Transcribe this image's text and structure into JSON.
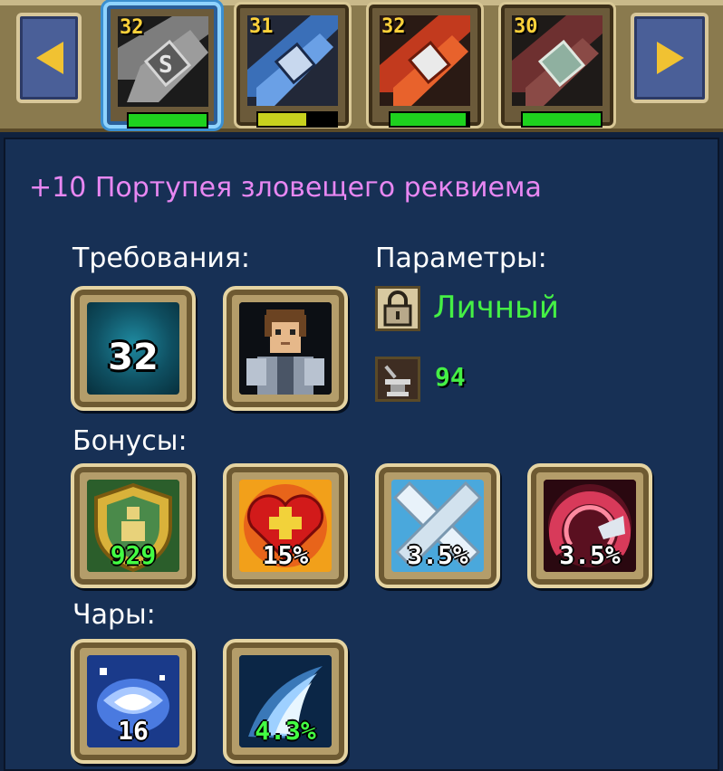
{
  "item_bar": {
    "slots": [
      {
        "level": "32",
        "durability": 1.0,
        "bar_color": "#1ed21e",
        "selected": true,
        "icon": "belt-iron-icon"
      },
      {
        "level": "31",
        "durability": 0.62,
        "bar_color": "#c8d21e",
        "selected": false,
        "icon": "belt-blue-icon"
      },
      {
        "level": "32",
        "durability": 0.97,
        "bar_color": "#1ed21e",
        "selected": false,
        "icon": "belt-red-icon"
      },
      {
        "level": "30",
        "durability": 1.0,
        "bar_color": "#1ed21e",
        "selected": false,
        "icon": "belt-green-icon"
      }
    ]
  },
  "item": {
    "title": "+10 Портупея зловещего реквиема",
    "title_color": "#e887f2"
  },
  "requirements": {
    "label": "Требования:",
    "level": "32",
    "class_icon": "knight-portrait-icon"
  },
  "parameters": {
    "label": "Параметры:",
    "binding": "Личный",
    "binding_icon": "lock-icon",
    "durability": "94",
    "durability_icon": "anvil-icon"
  },
  "bonuses": {
    "label": "Бонусы:",
    "items": [
      {
        "value": "929",
        "icon": "defense-shield-icon",
        "value_color": "green"
      },
      {
        "value": "15%",
        "icon": "health-heart-icon",
        "value_color": "white"
      },
      {
        "value": "3.5%",
        "icon": "crossed-swords-icon",
        "value_color": "white"
      },
      {
        "value": "3.5%",
        "icon": "crimson-arc-icon",
        "value_color": "white"
      }
    ]
  },
  "enchants": {
    "label": "Чары:",
    "items": [
      {
        "value": "16",
        "icon": "water-vortex-icon",
        "value_color": "white"
      },
      {
        "value": "4.3%",
        "icon": "frost-wave-icon",
        "value_color": "green"
      }
    ]
  }
}
